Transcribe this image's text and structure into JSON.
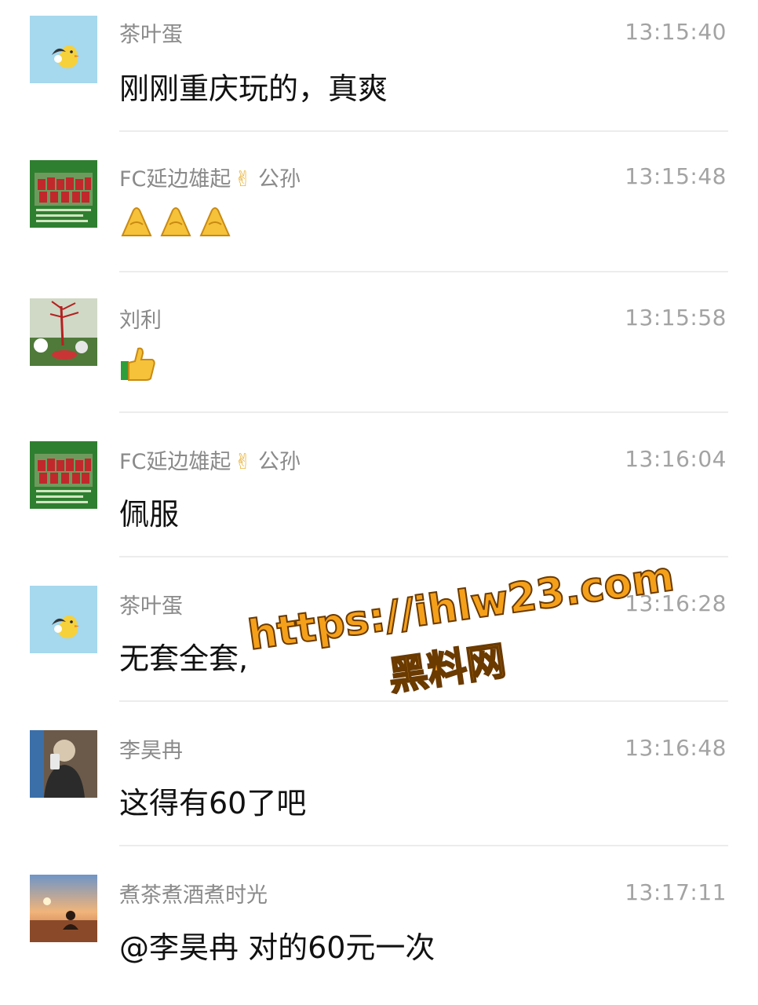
{
  "messages": [
    {
      "sender": "茶叶蛋",
      "time": "13:15:40",
      "text": "刚刚重庆玩的，真爽",
      "avatar": "duck-avatar"
    },
    {
      "sender": "FC延边雄起",
      "sender_emoji": "✌",
      "sender_suffix": "公孙",
      "time": "13:15:48",
      "text": "",
      "emoji": [
        "ok-hand",
        "ok-hand",
        "ok-hand"
      ],
      "avatar": "football-team-avatar"
    },
    {
      "sender": "刘利",
      "time": "13:15:58",
      "text": "",
      "emoji": [
        "thumbs-up"
      ],
      "avatar": "park-avatar"
    },
    {
      "sender": "FC延边雄起",
      "sender_emoji": "✌",
      "sender_suffix": "公孙",
      "time": "13:16:04",
      "text": "佩服",
      "avatar": "football-team-avatar"
    },
    {
      "sender": "茶叶蛋",
      "time": "13:16:28",
      "text": "无套全套,",
      "avatar": "duck-avatar"
    },
    {
      "sender": "李昊冉",
      "time": "13:16:48",
      "text": "这得有60了吧",
      "avatar": "selfie-avatar"
    },
    {
      "sender": "煮茶煮酒煮时光",
      "time": "13:17:11",
      "text": "@李昊冉 对的60元一次",
      "avatar": "sunset-avatar"
    }
  ],
  "watermark": {
    "url": "https://ihlw23.com",
    "name": "黑料网"
  },
  "colors": {
    "sender": "#8a8a8a",
    "time": "#a3a3a3",
    "text": "#111111",
    "divider": "#ececec",
    "watermark": "#f5a01a"
  }
}
